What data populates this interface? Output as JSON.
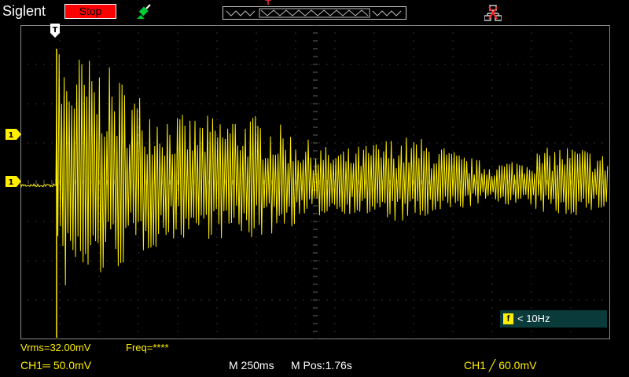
{
  "header": {
    "brand": "Siglent",
    "run_state": "Stop",
    "icons": {
      "probe": "probe-icon",
      "network": "network-icon",
      "memory": "memory-position-bar"
    }
  },
  "markers": {
    "trigger_position": "T",
    "channel_1": "1",
    "trigger_level": "1"
  },
  "freq_counter": {
    "icon": "f",
    "value": "< 10Hz"
  },
  "measurements": {
    "vrms": "Vrms=32.00mV",
    "freq": "Freq=****"
  },
  "status": {
    "ch1_scale": "CH1═ 50.0mV",
    "timebase": "M 250ms",
    "mpos": "M Pos:1.76s",
    "trigger": "CH1 ╱ 60.0mV"
  },
  "colors": {
    "trace": "#ffee00",
    "grid": "#646464",
    "run_state_bg": "#ff0000",
    "freq_box_bg": "#0a3a3a"
  }
}
